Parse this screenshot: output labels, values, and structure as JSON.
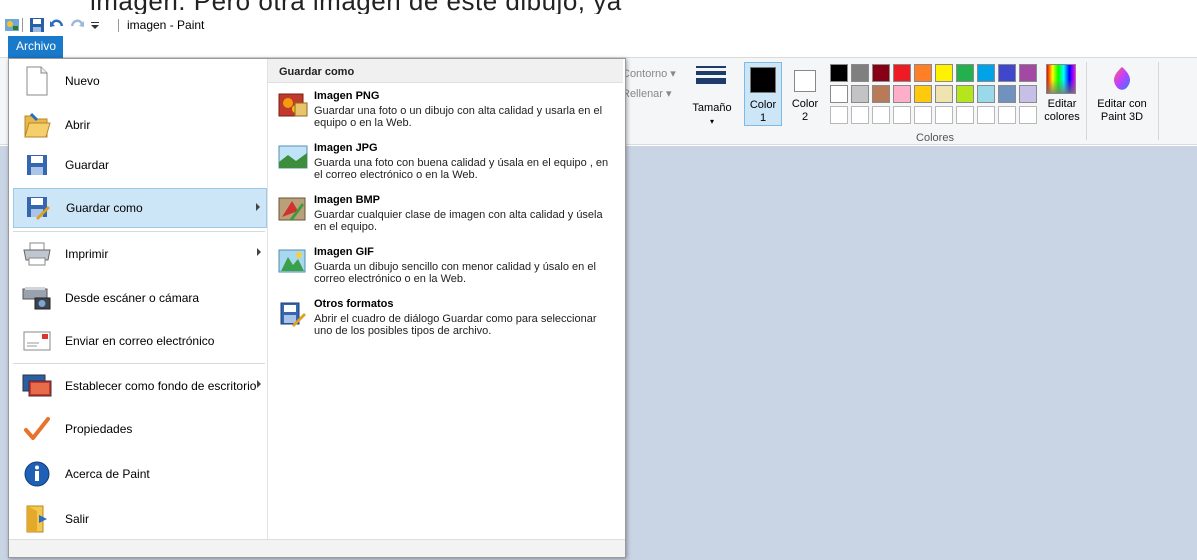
{
  "top_strip_text": "imagen. Pero otra imagen de este dibujo, ya",
  "window": {
    "title": "imagen - Paint"
  },
  "archivo_tab_label": "Archivo",
  "ribbon": {
    "contorno_label": "Contorno ▾",
    "rellenar_label": "Rellenar ▾",
    "tamano_label": "Tamaño",
    "tamano_caret": "▾",
    "color1_label": "Color",
    "color1_num": "1",
    "color2_label": "Color",
    "color2_num": "2",
    "editar_colores_line1": "Editar",
    "editar_colores_line2": "colores",
    "editar_paint3d_line1": "Editar con",
    "editar_paint3d_line2": "Paint 3D",
    "colores_group_label": "Colores",
    "palette_row1": [
      "#000000",
      "#7f7f7f",
      "#880015",
      "#ed1c24",
      "#ff7f27",
      "#fff200",
      "#22b14c",
      "#00a2e8",
      "#3f48cc",
      "#a349a4"
    ],
    "palette_row2": [
      "#ffffff",
      "#c3c3c3",
      "#b97a57",
      "#ffaec9",
      "#ffc90e",
      "#efe4b0",
      "#b5e61d",
      "#99d9ea",
      "#7092be",
      "#c8bfe7"
    ]
  },
  "menu": {
    "items": [
      {
        "label": "Nuevo",
        "icon": "new-file-icon"
      },
      {
        "label": "Abrir",
        "icon": "open-folder-icon"
      },
      {
        "label": "Guardar",
        "icon": "floppy-disk-icon"
      },
      {
        "label": "Guardar como",
        "icon": "save-as-icon"
      },
      {
        "label": "Imprimir",
        "icon": "printer-icon"
      },
      {
        "label": "Desde escáner o cámara",
        "icon": "scanner-camera-icon"
      },
      {
        "label": "Enviar en correo electrónico",
        "icon": "email-icon"
      },
      {
        "label": "Establecer como fondo de escritorio",
        "icon": "desktop-background-icon"
      },
      {
        "label": "Propiedades",
        "icon": "checkmark-icon"
      },
      {
        "label": "Acerca de Paint",
        "icon": "info-icon"
      },
      {
        "label": "Salir",
        "icon": "exit-icon"
      }
    ]
  },
  "submenu": {
    "header": "Guardar como",
    "items": [
      {
        "title": "Imagen PNG",
        "desc": "Guardar una foto o un dibujo con alta calidad y usarla en el equipo o en la Web.",
        "icon": "png-image-icon"
      },
      {
        "title": "Imagen JPG",
        "desc": "Guarda una foto con buena calidad y úsala en el equipo , en el correo electrónico o en la Web.",
        "icon": "jpg-image-icon"
      },
      {
        "title": "Imagen BMP",
        "desc": "Guardar cualquier clase de imagen con alta calidad y úsela en el equipo.",
        "icon": "bmp-image-icon"
      },
      {
        "title": "Imagen GIF",
        "desc": "Guarda un dibujo sencillo con menor calidad y úsalo en el correo electrónico o en la Web.",
        "icon": "gif-image-icon"
      },
      {
        "title": "Otros formatos",
        "desc": "Abrir el cuadro de diálogo Guardar como para seleccionar uno de los posibles tipos de archivo.",
        "icon": "other-formats-icon"
      }
    ]
  }
}
